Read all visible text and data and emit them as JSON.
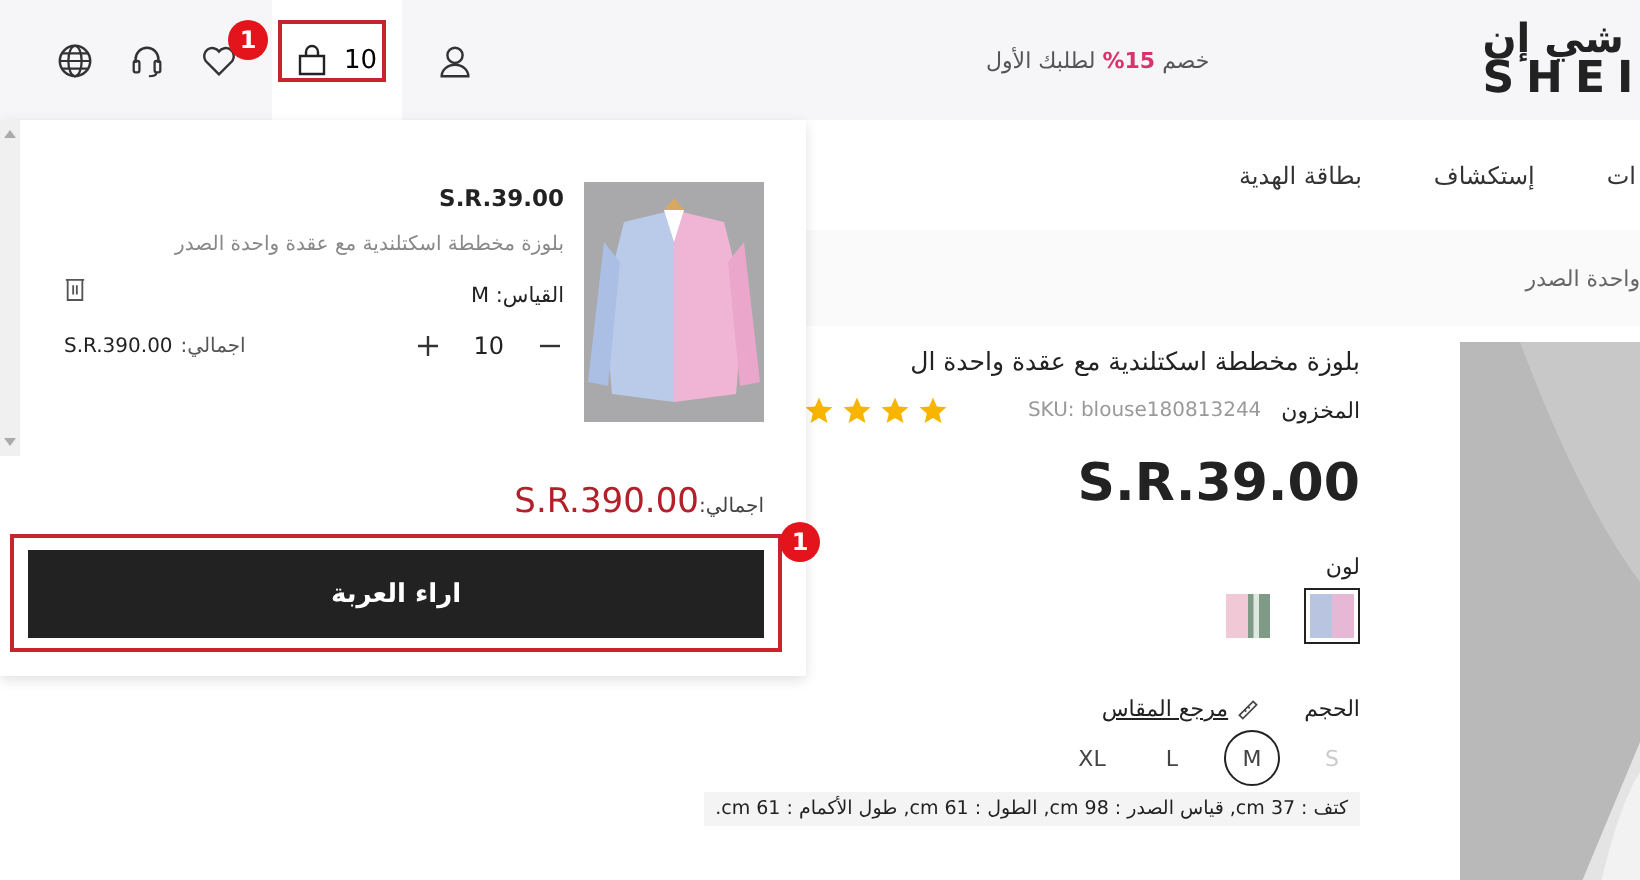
{
  "topbar": {
    "cart_count": "10",
    "promo": "خصم **%15** لطلبك الأول",
    "logo": {
      "arabic": "شي إن",
      "latin": "SHEI"
    }
  },
  "nav": [
    "ات",
    "إستكشاف",
    "بطاقة الهدية"
  ],
  "breadcrumb": "واحدة الصدر",
  "product": {
    "title": "بلوزة مخططة اسكتلندية مع عقدة واحدة ال",
    "stock_label": "المخزون",
    "sku": "SKU: blouse180813244",
    "stars": 4,
    "price": "S.R.39.00",
    "color_label": "لون",
    "colors": [
      {
        "selected": true,
        "kind": "blue-pink"
      },
      {
        "selected": false,
        "kind": "pink-green"
      }
    ],
    "size_label": "الحجم",
    "size_guide": "مرجع المقاس",
    "sizes": [
      {
        "label": "S",
        "selected": false,
        "disabled": true
      },
      {
        "label": "M",
        "selected": true,
        "disabled": false
      },
      {
        "label": "L",
        "selected": false,
        "disabled": false
      },
      {
        "label": "XL",
        "selected": false,
        "disabled": false
      }
    ],
    "measurements": "كتف : 37 cm,  قياس الصدر : 98 cm,  الطول : 61 cm,  طول الأكمام : 61 cm."
  },
  "cart": {
    "items": [
      {
        "price": "S.R.39.00",
        "name": "بلوزة مخططة اسكتلندية مع عقدة واحدة الصدر",
        "size": "القياس: M",
        "quantity": "10",
        "total_label": "اجمالي:",
        "total": "S.R.390.00"
      }
    ],
    "total_label": "اجمالي:",
    "total": "S.R.390.00",
    "button": "اراء العربة"
  },
  "annotations": [
    {
      "label": "1"
    },
    {
      "label": "1"
    }
  ]
}
